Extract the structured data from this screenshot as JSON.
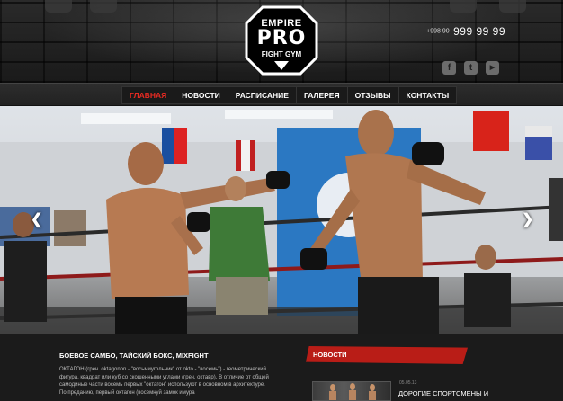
{
  "header": {
    "logo": {
      "line1": "EMPIRE",
      "line2": "PRO",
      "line3": "FIGHT GYM"
    },
    "phone": {
      "code": "+998 90",
      "number": "999 99 99"
    },
    "social": [
      {
        "icon": "facebook-icon",
        "glyph": "f"
      },
      {
        "icon": "twitter-icon",
        "glyph": "t"
      },
      {
        "icon": "youtube-icon",
        "glyph": "▶"
      }
    ]
  },
  "nav": {
    "items": [
      "ГЛАВНАЯ",
      "НОВОСТИ",
      "РАСПИСАНИЕ",
      "ГАЛЕРЕЯ",
      "ОТЗЫВЫ",
      "КОНТАКТЫ"
    ],
    "active_index": 0,
    "active_color": "#e52a22"
  },
  "hero": {
    "prev_glyph": "❮",
    "next_glyph": "❯"
  },
  "about": {
    "title": "БОЕВОЕ САМБО, ТАЙСКИЙ БОКС, MIXFIGHT",
    "text": "ОКТАГОН (греч. oktagonon - \"восьмиугольник\" от okto - \"восемь\") - геометрический фигура, квадрат или куб со скошенными углами (греч. октавр). В отличие от общей самодиные части восемь первых \"октагон\" используют в основном в архитектуре. По преданию, первый октагон (восемнуй замок имура"
  },
  "news": {
    "heading": "НОВОСТИ",
    "item": {
      "date": "05.05.13",
      "title": "ДОРОГИЕ СПОРТСМЕНЫ И"
    }
  },
  "colors": {
    "accent_red": "#e52a22",
    "news_banner": "#b91d17"
  }
}
